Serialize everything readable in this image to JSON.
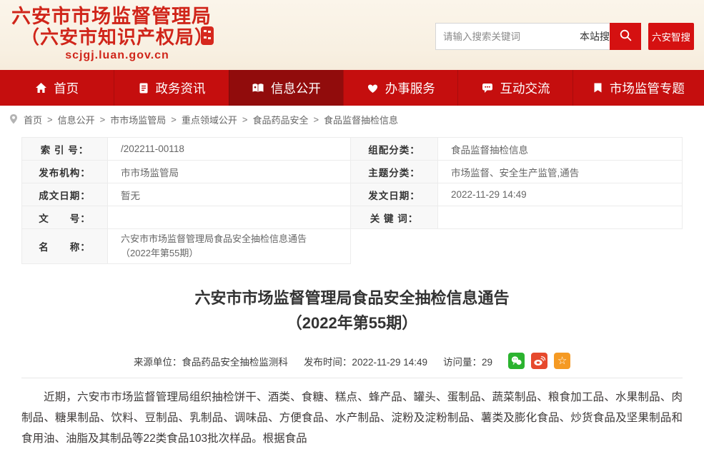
{
  "header": {
    "org_name_line1": "六安市市场监督管理局",
    "org_name_line2": "（六安市知识产权局）",
    "site_url": "scjgj.luan.gov.cn",
    "search": {
      "placeholder": "请输入搜索关键词",
      "scope_label": "本站搜",
      "smart_search_label": "六安智搜"
    }
  },
  "nav": {
    "items": [
      {
        "label": "首页"
      },
      {
        "label": "政务资讯"
      },
      {
        "label": "信息公开"
      },
      {
        "label": "办事服务"
      },
      {
        "label": "互动交流"
      },
      {
        "label": "市场监管专题"
      }
    ]
  },
  "breadcrumb": {
    "separator": ">",
    "items": [
      "首页",
      "信息公开",
      "市市场监管局",
      "重点领域公开",
      "食品药品安全",
      "食品监督抽检信息"
    ]
  },
  "info_table": {
    "index_label": "索 引 号：",
    "index_value": "/202211-00118",
    "category_label": "组配分类：",
    "category_value": "食品监督抽检信息",
    "agency_label": "发布机构：",
    "agency_value": "市市场监管局",
    "topic_label": "主题分类：",
    "topic_value": "市场监督、安全生产监管,通告",
    "written_date_label": "成文日期：",
    "written_date_value": "暂无",
    "publish_date_label": "发文日期：",
    "publish_date_value": "2022-11-29 14:49",
    "doc_no_label": "文　　号：",
    "doc_no_value": "",
    "keywords_label": "关 键 词：",
    "keywords_value": "",
    "name_label": "名　　称：",
    "name_value": "六安市市场监督管理局食品安全抽检信息通告\n（2022年第55期）"
  },
  "article": {
    "title_line1": "六安市市场监督管理局食品安全抽检信息通告",
    "title_line2": "（2022年第55期）",
    "source_label": "来源单位：食品药品安全抽检监测科",
    "publish_time_label": "发布时间：2022-11-29 14:49",
    "visits_label": "访问量：29",
    "star_glyph": "☆",
    "body_paragraph": "近期，六安市市场监督管理局组织抽检饼干、酒类、食糖、糕点、蜂产品、罐头、蛋制品、蔬菜制品、粮食加工品、水果制品、肉制品、糖果制品、饮料、豆制品、乳制品、调味品、方便食品、水产制品、淀粉及淀粉制品、薯类及膨化食品、炒货食品及坚果制品和食用油、油脂及其制品等22类食品103批次样品。根据食品"
  },
  "colors": {
    "nav_red": "#c50e0e",
    "nav_active_red": "#910c0c",
    "brand_red": "#d0251a",
    "button_red": "#d51111",
    "wechat_green": "#2bb32f",
    "weibo_orange": "#e6492d",
    "star_orange": "#f59a23"
  }
}
